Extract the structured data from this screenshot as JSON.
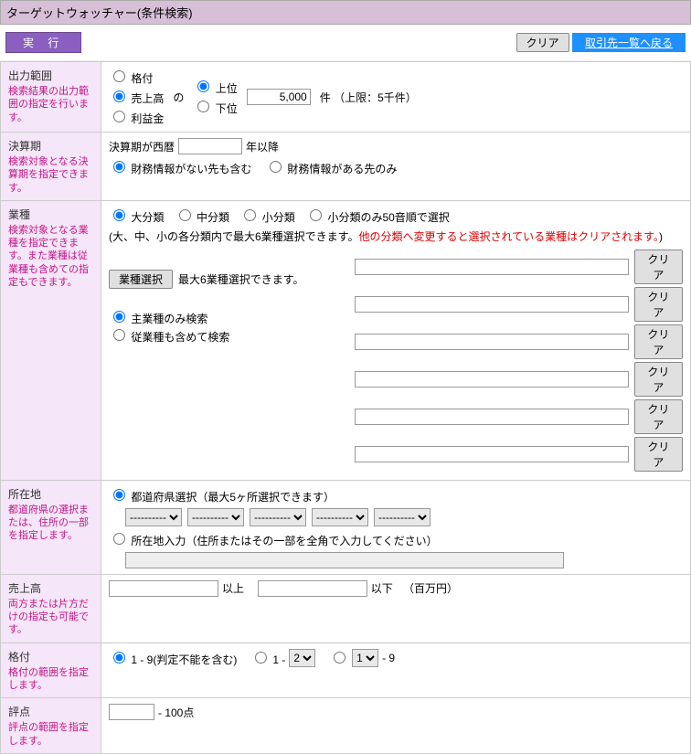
{
  "header": {
    "title": "ターゲットウォッチャー(条件検索)"
  },
  "toolbar": {
    "exec": "実  行",
    "clear": "クリア",
    "back": "取引先一覧へ戻る"
  },
  "sections": {
    "output": {
      "title": "出力範囲",
      "desc": "検索結果の出力範囲の指定を行います。"
    },
    "period": {
      "title": "決算期",
      "desc": "検索対象となる決算期を指定できます。"
    },
    "industry": {
      "title": "業種",
      "desc": "検索対象となる業種を指定できます。また業種は従業種も含めての指定もできます。"
    },
    "location": {
      "title": "所在地",
      "desc": "都道府県の選択または、住所の一部を指定します。"
    },
    "sales": {
      "title": "売上高",
      "desc": "両方または片方だけの指定も可能です。"
    },
    "rating": {
      "title": "格付",
      "desc": "格付の範囲を指定します。"
    },
    "score": {
      "title": "評点",
      "desc": "評点の範囲を指定します。"
    }
  },
  "output": {
    "opt_rating": "格付",
    "opt_sales": "売上高",
    "opt_profit": "利益金",
    "of": "の",
    "opt_top": "上位",
    "opt_bottom": "下位",
    "count_value": "5,000",
    "count_suffix": "件  （上限：5千件）"
  },
  "period": {
    "prefix": "決算期が西暦",
    "year_value": "",
    "suffix": "年以降",
    "opt_incl_none": "財務情報がない先も含む",
    "opt_only_have": "財務情報がある先のみ"
  },
  "industry": {
    "cls_large": "大分類",
    "cls_mid": "中分類",
    "cls_small": "小分類",
    "cls_small50": "小分類のみ50音順で選択",
    "note_main": "(大、中、小の各分類内で最大6業種選択できます。",
    "note_red": "他の分類へ変更すると選択されている業種はクリアされます。",
    "note_close": ")",
    "select_btn": "業種選択",
    "select_note": "最大6業種選択できます。",
    "clear": "クリア",
    "opt_main_only": "主業種のみ検索",
    "opt_incl_sub": "従業種も含めて検索"
  },
  "location": {
    "opt_pref": "都道府県選択（最大5ヶ所選択できます）",
    "placeholder": "----------",
    "opt_addr": "所在地入力（住所またはその一部を全角で入力してください）",
    "addr_value": ""
  },
  "sales": {
    "from": "",
    "to": "",
    "ge": "以上",
    "le": "以下",
    "unit": "（百万円）"
  },
  "rating": {
    "opt_all": "1 - 9(判定不能を含む)",
    "opt_from": "1 - ",
    "from_val": "2",
    "opt_to_sel": "1",
    "opt_to_suffix": " - 9"
  },
  "score": {
    "value": "",
    "suffix": " - 100点"
  }
}
